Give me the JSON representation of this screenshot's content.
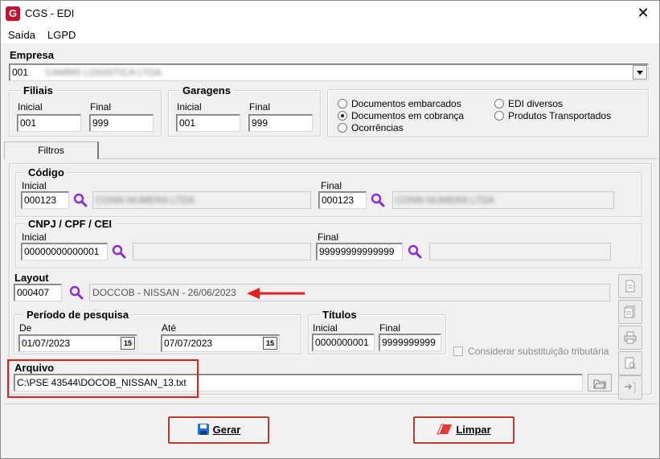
{
  "window": {
    "title": "CGS - EDI",
    "close_glyph": "✕",
    "icon_letter": "G"
  },
  "menu": [
    "Saída",
    "LGPD"
  ],
  "empresa": {
    "label": "Empresa",
    "code": "001",
    "name": "CAMMS LOGISTICA LTDA"
  },
  "filiais": {
    "title": "Filiais",
    "inicial_label": "Inicial",
    "final_label": "Final",
    "inicial": "001",
    "final": "999"
  },
  "garagens": {
    "title": "Garagens",
    "inicial_label": "Inicial",
    "final_label": "Final",
    "inicial": "001",
    "final": "999"
  },
  "options": {
    "items": [
      {
        "label": "Documentos embarcados",
        "selected": false
      },
      {
        "label": "Documentos em cobrança",
        "selected": true
      },
      {
        "label": "Ocorrências",
        "selected": false
      },
      {
        "label": "EDI diversos",
        "selected": false
      },
      {
        "label": "Produtos Transportados",
        "selected": false
      }
    ]
  },
  "tab": {
    "label": "Filtros"
  },
  "codigo": {
    "title": "Código",
    "inicial_label": "Inicial",
    "final_label": "Final",
    "inicial": "000123",
    "inicial_name": "CONN NUMERA LTDA",
    "final": "000123",
    "final_name": "CONN NUMERA LTDA"
  },
  "cnpj": {
    "title": "CNPJ / CPF / CEI",
    "inicial_label": "Inicial",
    "final_label": "Final",
    "inicial": "00000000000001",
    "final": "99999999999999"
  },
  "layout": {
    "label": "Layout",
    "code": "000407",
    "description": "DOCCOB - NISSAN - 26/06/2023"
  },
  "periodo": {
    "title": "Período de pesquisa",
    "de_label": "De",
    "ate_label": "Até",
    "de": "01/07/2023",
    "ate": "07/07/2023",
    "cal_label": "15"
  },
  "titulos": {
    "title": "Títulos",
    "inicial_label": "Inicial",
    "final_label": "Final",
    "inicial": "0000000001",
    "final": "9999999999"
  },
  "considerar": {
    "label": "Considerar substituição tributária",
    "checked": false
  },
  "arquivo": {
    "label": "Arquivo",
    "path": "C:\\PSE 43544\\DOCOB_NISSAN_13.txt"
  },
  "buttons": {
    "gerar": "Gerar",
    "limpar": "Limpar"
  },
  "colors": {
    "highlight": "#e02020",
    "search": "#8a2be2"
  }
}
